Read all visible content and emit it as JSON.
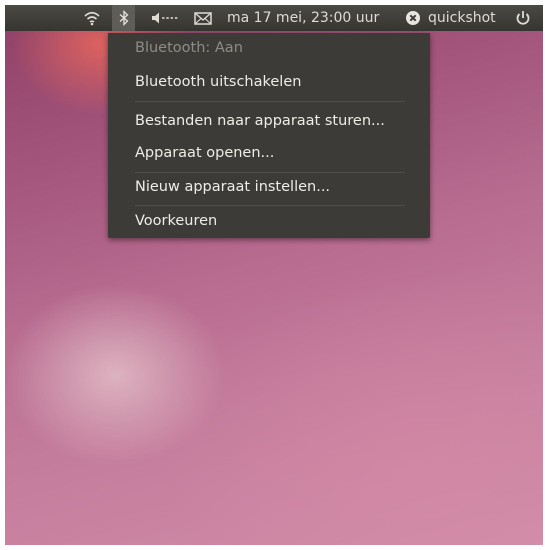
{
  "panel": {
    "datetime": "ma 17 mei, 23:00 uur",
    "user": "quickshot",
    "icons": [
      "network-wireless-icon",
      "bluetooth-icon",
      "volume-icon",
      "mail-icon",
      "chat-status-icon",
      "power-icon"
    ]
  },
  "bluetooth_menu": {
    "status": "Bluetooth: Aan",
    "items": [
      "Bluetooth uitschakelen",
      "Bestanden naar apparaat sturen...",
      "Apparaat openen...",
      "Nieuw apparaat instellen...",
      "Voorkeuren"
    ]
  },
  "colors": {
    "panel": "#3c3b37",
    "menu": "#3c3b37",
    "menu_text": "#efece7",
    "menu_text_disabled": "#8f8c85",
    "wallpaper": "#b86c90"
  }
}
